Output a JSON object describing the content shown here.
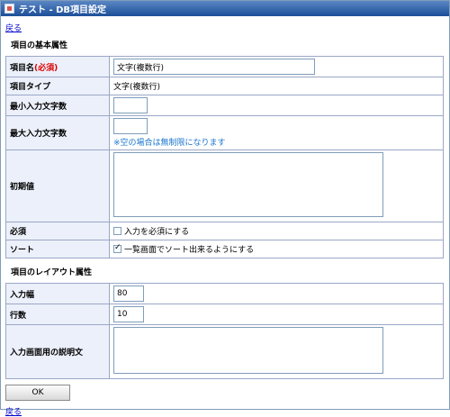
{
  "window": {
    "title": "テスト - DB項目設定"
  },
  "nav": {
    "back_top": "戻る",
    "back_bottom": "戻る"
  },
  "basic": {
    "section_title": "項目の基本属性",
    "name": {
      "label": "項目名",
      "required_mark": "(必須)",
      "value": "文字(複数行)"
    },
    "type": {
      "label": "項目タイプ",
      "value": "文字(複数行)"
    },
    "min_chars": {
      "label": "最小入力文字数",
      "value": ""
    },
    "max_chars": {
      "label": "最大入力文字数",
      "value": "",
      "note": "※空の場合は無制限になります"
    },
    "initial": {
      "label": "初期値",
      "value": ""
    },
    "required": {
      "label": "必須",
      "option": "入力を必須にする",
      "checked": false
    },
    "sort": {
      "label": "ソート",
      "option": "一覧画面でソート出来るようにする",
      "checked": true
    }
  },
  "layout": {
    "section_title": "項目のレイアウト属性",
    "width": {
      "label": "入力幅",
      "value": "80"
    },
    "rows": {
      "label": "行数",
      "value": "10"
    },
    "description": {
      "label": "入力画面用の説明文",
      "value": ""
    }
  },
  "actions": {
    "ok_label": "OK"
  }
}
